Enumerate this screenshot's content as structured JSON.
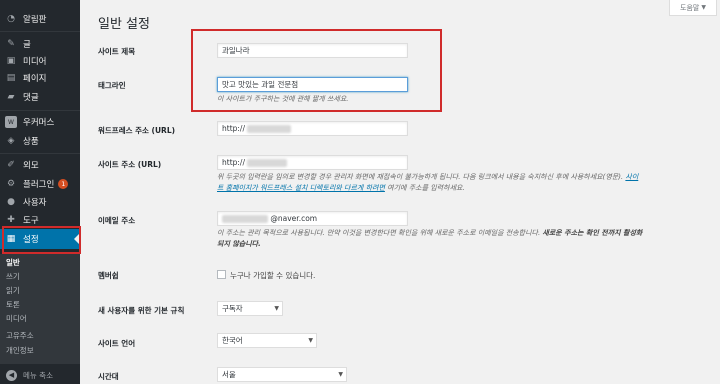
{
  "sidebar": {
    "items": [
      {
        "label": "알림판",
        "icon": "dashboard-icon",
        "glyph": "◔"
      },
      {
        "label": "글",
        "icon": "pin-icon",
        "glyph": "✎"
      },
      {
        "label": "미디어",
        "icon": "media-icon",
        "glyph": "▣"
      },
      {
        "label": "페이지",
        "icon": "page-icon",
        "glyph": "▤"
      },
      {
        "label": "댓글",
        "icon": "comment-icon",
        "glyph": "▰"
      },
      {
        "label": "우커머스",
        "icon": "woo-icon",
        "glyph": "W"
      },
      {
        "label": "상품",
        "icon": "archive-icon",
        "glyph": "◈"
      },
      {
        "label": "외모",
        "icon": "brush-icon",
        "glyph": "✐"
      },
      {
        "label": "플러그인",
        "icon": "plugin-icon",
        "glyph": "⚙",
        "badge": "1"
      },
      {
        "label": "사용자",
        "icon": "user-icon",
        "glyph": "●"
      },
      {
        "label": "도구",
        "icon": "tools-icon",
        "glyph": "✚"
      },
      {
        "label": "설정",
        "icon": "settings-icon",
        "glyph": "▦"
      }
    ],
    "submenu": [
      "일반",
      "쓰기",
      "읽기",
      "토론",
      "미디어",
      "고유주소",
      "개인정보"
    ],
    "collapse_label": "메뉴 축소"
  },
  "header": {
    "title": "일반 설정",
    "help_label": "도움말"
  },
  "form": {
    "site_title_label": "사이트 제목",
    "site_title_value": "과일나라",
    "tagline_label": "태그라인",
    "tagline_value": "맛고 맛있는 과일 전문점",
    "tagline_desc": "이 사이트가 주구하는 것에 관해 짧게 쓰세요.",
    "wp_address_label": "워드프레스 주소 (URL)",
    "wp_address_value": "http://",
    "site_address_label": "사이트 주소 (URL)",
    "site_address_value": "http://",
    "site_address_desc_1": "위 두곳의 입력란을 임의로 변경할 경우 관리자 화면에 재접속이 불가능하게 됩니다. 다음 링크에서 내용을 숙지하신 후에 사용하세요(영문).",
    "site_address_desc_link_1": "사이",
    "site_address_desc_link_2": "트 홈페이지가 워드프레스 설치 디렉토리와 다르게 하려면",
    "site_address_desc_2": "여기에 주소를 입력하세요.",
    "email_label": "이메일 주소",
    "email_value_suffix": "@naver.com",
    "email_desc_1": "이 주소는 관리 목적으로 사용됩니다. 만약 이것을 변경한다면 확인을 위해 새로운 주소로 이메일을 전송합니다.",
    "email_desc_strong": "새로운 주소는 확인 전까지 활성화",
    "email_desc_strong_2": "되지 않습니다.",
    "membership_label": "멤버쉽",
    "membership_checkbox_label": "누구나 가입할 수 있습니다.",
    "default_role_label": "새 사용자를 위한 기본 규칙",
    "default_role_value": "구독자",
    "language_label": "사이트 언어",
    "language_value": "한국어",
    "timezone_label": "시간대",
    "timezone_value": "서울"
  },
  "colors": {
    "sidebar_bg": "#23282d",
    "active": "#0073aa",
    "highlight": "#d02b2b"
  }
}
